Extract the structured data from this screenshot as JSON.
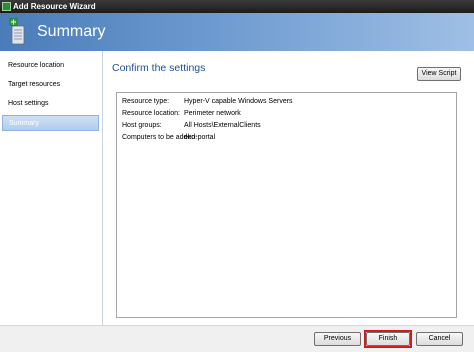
{
  "window": {
    "title": "Add Resource Wizard"
  },
  "header": {
    "title": "Summary"
  },
  "sidebar": {
    "items": [
      {
        "label": "Resource location"
      },
      {
        "label": "Target resources"
      },
      {
        "label": "Host settings"
      },
      {
        "label": "Summary",
        "selected": true
      }
    ]
  },
  "main": {
    "title": "Confirm the settings",
    "view_script_label": "View Script",
    "settings": [
      {
        "key": "Resource type:",
        "value": "Hyper-V capable Windows Servers"
      },
      {
        "key": "Resource location:",
        "value": "Perimeter network"
      },
      {
        "key": "Host groups:",
        "value": "All Hosts\\ExternalClients"
      },
      {
        "key": "Computers to be added:",
        "value": "eko-portal"
      }
    ]
  },
  "footer": {
    "previous_label": "Previous",
    "finish_label": "Finish",
    "cancel_label": "Cancel"
  },
  "colors": {
    "header_gradient_start": "#4a7cb8",
    "header_gradient_end": "#9fbfe5",
    "title_accent": "#1e4e9c",
    "highlight": "#d21a1a"
  },
  "icons": [
    "wizard-window-icon",
    "server-add-icon"
  ]
}
